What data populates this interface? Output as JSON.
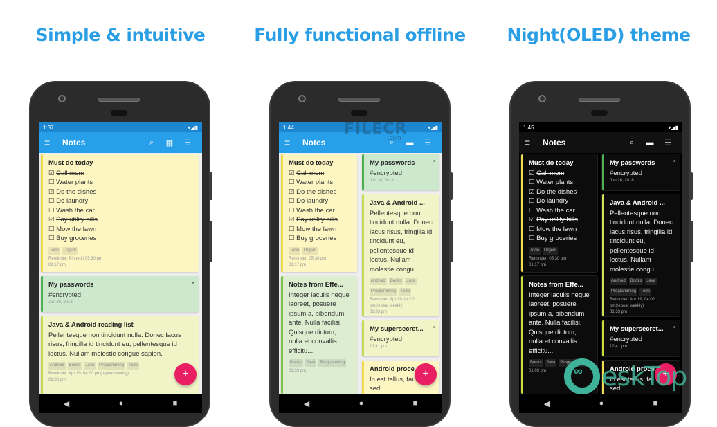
{
  "headlines": [
    "Simple & intuitive",
    "Fully functional offline",
    "Night(OLED) theme"
  ],
  "colors": {
    "headline": "#2a9ee4",
    "appbar": "#27a0e9",
    "fab": "#e91e63",
    "yellow": "#fdf6c3",
    "green": "#cce8cd",
    "lime": "#f1f4c7"
  },
  "phones": [
    {
      "status_time": "1:37",
      "status_icons": "▾◢▮",
      "app_title": "Notes",
      "icons": {
        "menu": "≡",
        "search": "⌕",
        "view": "▦",
        "sort": "☰"
      },
      "fab": "+",
      "nav": {
        "back": "◀",
        "home": "●",
        "recents": "■"
      },
      "notes": [
        {
          "title": "Must do today",
          "items": [
            {
              "text": "Call mom",
              "checked": true
            },
            {
              "text": "Water plants",
              "checked": false
            },
            {
              "text": "Do the dishes",
              "checked": true
            },
            {
              "text": "Do laundry",
              "checked": false
            },
            {
              "text": "Wash the car",
              "checked": false
            },
            {
              "text": "Pay utility bills",
              "checked": true
            },
            {
              "text": "Mow the lawn",
              "checked": false
            },
            {
              "text": "Buy groceries",
              "checked": false
            }
          ],
          "tags": [
            "Todo",
            "Urgent"
          ],
          "meta": [
            "Reminder: Pinned | 05:30 pm",
            "01:17 pm"
          ]
        },
        {
          "title": "My passwords",
          "body": "#encrypted",
          "meta": [
            "Jun 26, 2018"
          ],
          "star": "*"
        },
        {
          "title": "Java & Android reading list",
          "body": "Pellentesque non tincidunt nulla. Donec lacus risus, fringilla id tincidunt eu, pellentesque id lectus. Nullam molestie congue sapien.",
          "tags": [
            "Android",
            "Books",
            "Java",
            "Programming",
            "Todo"
          ],
          "meta": [
            "Reminder: Apr 19, 04:00 pm(repeat weekly)",
            "01:33 pm"
          ]
        }
      ]
    },
    {
      "status_time": "1:44",
      "status_icons": "▾◢▮",
      "app_title": "Notes",
      "icons": {
        "menu": "≡",
        "search": "⌕",
        "view": "▬",
        "sort": "☰"
      },
      "fab": "+",
      "nav": {
        "back": "◀",
        "home": "●",
        "recents": "■"
      },
      "notes": [
        {
          "title": "Must do today",
          "items": [
            {
              "text": "Call mom",
              "checked": true
            },
            {
              "text": "Water plants",
              "checked": false
            },
            {
              "text": "Do the dishes",
              "checked": true
            },
            {
              "text": "Do laundry",
              "checked": false
            },
            {
              "text": "Wash the car",
              "checked": false
            },
            {
              "text": "Pay utility bills",
              "checked": true
            },
            {
              "text": "Mow the lawn",
              "checked": false
            },
            {
              "text": "Buy groceries",
              "checked": false
            }
          ],
          "tags": [
            "Todo",
            "Urgent"
          ],
          "meta": [
            "Reminder: 05:30 pm",
            "01:17 pm"
          ]
        },
        {
          "title": "Notes from Effe...",
          "body": "Integer iaculis neque laoreet, posuere ipsum a, bibendum ante. Nulla facilisi. Quisque dictum, nulla et convallis efficitu...",
          "tags": [
            "Books",
            "Java",
            "Programming"
          ],
          "meta": [
            "01:33 pm"
          ]
        },
        {
          "title": "My passwords",
          "body": "#encrypted",
          "meta": [
            "Jun 26, 2018"
          ],
          "star": "*"
        },
        {
          "title": "Java & Android ...",
          "body": "Pellentesque non tincidunt nulla. Donec lacus risus, fringilla id tincidunt eu, pellentesque id lectus. Nullam molestie congu...",
          "tags": [
            "Android",
            "Books",
            "Java",
            "Programming",
            "Todo"
          ],
          "meta": [
            "Reminder: Apr 19, 04:02 pm(repeat weekly)",
            "01:33 pm"
          ]
        },
        {
          "title": "My supersecret...",
          "body": "#encrypted",
          "meta": [
            "12:41 pm"
          ],
          "star": "*"
        },
        {
          "title": "Android proce...",
          "body": "In est tellus, faucibus sed"
        }
      ]
    },
    {
      "status_time": "1:45",
      "status_icons": "▾◢▮",
      "app_title": "Notes",
      "icons": {
        "menu": "≡",
        "search": "⌕",
        "view": "▬",
        "sort": "☰"
      },
      "fab": "+",
      "nav": {
        "back": "◀",
        "home": "●",
        "recents": "■"
      },
      "notes": [
        {
          "title": "Must do today",
          "items": [
            {
              "text": "Call mom",
              "checked": true
            },
            {
              "text": "Water plants",
              "checked": false
            },
            {
              "text": "Do the dishes",
              "checked": true
            },
            {
              "text": "Do laundry",
              "checked": false
            },
            {
              "text": "Wash the car",
              "checked": false
            },
            {
              "text": "Pay utility bills",
              "checked": true
            },
            {
              "text": "Mow the lawn",
              "checked": false
            },
            {
              "text": "Buy groceries",
              "checked": false
            }
          ],
          "tags": [
            "Todo",
            "Urgent"
          ],
          "meta": [
            "Reminder: 05:30 pm",
            "01:17 pm"
          ]
        },
        {
          "title": "Notes from Effe...",
          "body": "Integer iaculis neque laoreet, posuere ipsum a, bibendum ante. Nulla facilisi. Quisque dictum, nulla et convallis efficitu...",
          "tags": [
            "Books",
            "Java",
            "Programming"
          ],
          "meta": [
            "01:03 pm"
          ]
        },
        {
          "title": "My passwords",
          "body": "#encrypted",
          "meta": [
            "Jun 26, 2018"
          ],
          "star": "*"
        },
        {
          "title": "Java & Android ...",
          "body": "Pellentesque non tincidunt nulla. Donec lacus risus, fringilla id tincidunt eu, pellentesque id lectus. Nullam molestie congu...",
          "tags": [
            "Android",
            "Books",
            "Java",
            "Programming",
            "Todo"
          ],
          "meta": [
            "Reminder: Apr 19, 04:02 pm(repeat weekly)",
            "01:33 pm"
          ]
        },
        {
          "title": "My supersecret...",
          "body": "#encrypted",
          "meta": [
            "12:41 pm"
          ],
          "star": "*"
        },
        {
          "title": "Android proce...",
          "body": "In est tellus, faucibus sed"
        }
      ]
    }
  ],
  "watermarks": {
    "filecr": "FILECR",
    "filecr_com": ".com",
    "desktop": "eskTop"
  }
}
